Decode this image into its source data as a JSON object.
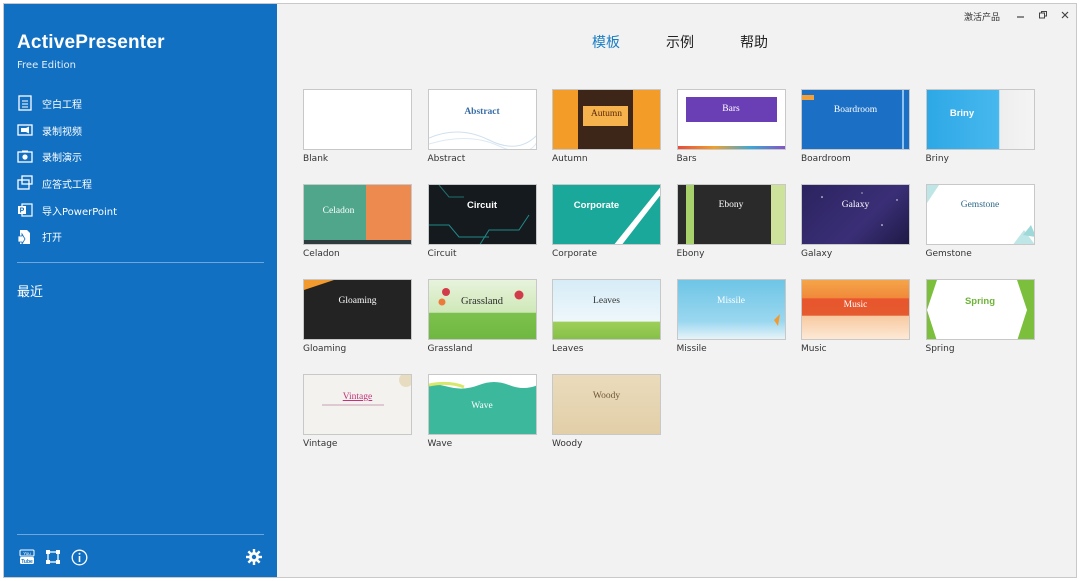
{
  "app": {
    "title": "ActivePresenter",
    "edition": "Free Edition",
    "activate_label": "激活产品"
  },
  "sidebar": {
    "items": [
      {
        "label": "空白工程",
        "icon": "blank-doc-icon"
      },
      {
        "label": "录制视频",
        "icon": "record-video-icon"
      },
      {
        "label": "录制演示",
        "icon": "record-demo-icon"
      },
      {
        "label": "应答式工程",
        "icon": "responsive-project-icon"
      },
      {
        "label": "导入PowerPoint",
        "icon": "powerpoint-icon"
      },
      {
        "label": "打开",
        "icon": "open-folder-icon"
      }
    ],
    "recent_label": "最近"
  },
  "tabs": [
    {
      "label": "模板",
      "active": true
    },
    {
      "label": "示例",
      "active": false
    },
    {
      "label": "帮助",
      "active": false
    }
  ],
  "templates": [
    {
      "name": "Blank",
      "thumb": ""
    },
    {
      "name": "Abstract",
      "thumb": "Abstract"
    },
    {
      "name": "Autumn",
      "thumb": "Autumn"
    },
    {
      "name": "Bars",
      "thumb": "Bars"
    },
    {
      "name": "Boardroom",
      "thumb": "Boardroom"
    },
    {
      "name": "Briny",
      "thumb": "Briny"
    },
    {
      "name": "Celadon",
      "thumb": "Celadon"
    },
    {
      "name": "Circuit",
      "thumb": "Circuit"
    },
    {
      "name": "Corporate",
      "thumb": "Corporate"
    },
    {
      "name": "Ebony",
      "thumb": "Ebony"
    },
    {
      "name": "Galaxy",
      "thumb": "Galaxy"
    },
    {
      "name": "Gemstone",
      "thumb": "Gemstone"
    },
    {
      "name": "Gloaming",
      "thumb": "Gloaming"
    },
    {
      "name": "Grassland",
      "thumb": "Grassland"
    },
    {
      "name": "Leaves",
      "thumb": "Leaves"
    },
    {
      "name": "Missile",
      "thumb": "Missile"
    },
    {
      "name": "Music",
      "thumb": "Music"
    },
    {
      "name": "Spring",
      "thumb": "Spring"
    },
    {
      "name": "Vintage",
      "thumb": "Vintage"
    },
    {
      "name": "Wave",
      "thumb": "Wave"
    },
    {
      "name": "Woody",
      "thumb": "Woody"
    }
  ],
  "colors": {
    "sidebar": "#1170c2",
    "accent": "#1a7dc4",
    "background": "#f2f2f2"
  }
}
